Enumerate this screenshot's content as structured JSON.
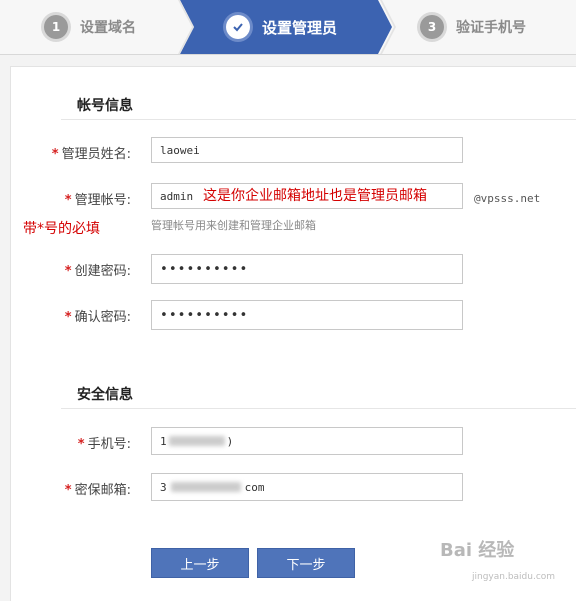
{
  "steps": [
    {
      "num": "1",
      "label": "设置域名"
    },
    {
      "label": "设置管理员"
    },
    {
      "num": "3",
      "label": "验证手机号"
    }
  ],
  "sections": {
    "account": "帐号信息",
    "security": "安全信息"
  },
  "fields": {
    "admin_name": {
      "label": "管理员姓名:",
      "value": "laowei"
    },
    "admin_account": {
      "label": "管理帐号:",
      "value": "admin",
      "suffix": "@vpsss.net",
      "hint": "管理帐号用来创建和管理企业邮箱"
    },
    "create_password": {
      "label": "创建密码:",
      "value": "••••••••••"
    },
    "confirm_password": {
      "label": "确认密码:",
      "value": "••••••••••"
    },
    "phone": {
      "label": "手机号:",
      "value_prefix": "1",
      "value_suffix": ")"
    },
    "security_email": {
      "label": "密保邮箱:",
      "value_prefix": "3",
      "value_suffix": "com"
    }
  },
  "annotations": {
    "account_note": "这是你企业邮箱地址也是管理员邮箱",
    "required_note": "带*号的必填",
    "star": "*"
  },
  "buttons": {
    "prev": "上一步",
    "next": "下一步"
  },
  "watermark": {
    "main": "Bai 经验",
    "sub": "jingyan.baidu.com"
  },
  "colors": {
    "accent": "#3c63b1",
    "required": "#d62222",
    "note": "#d40000",
    "button": "#4f74ba"
  }
}
